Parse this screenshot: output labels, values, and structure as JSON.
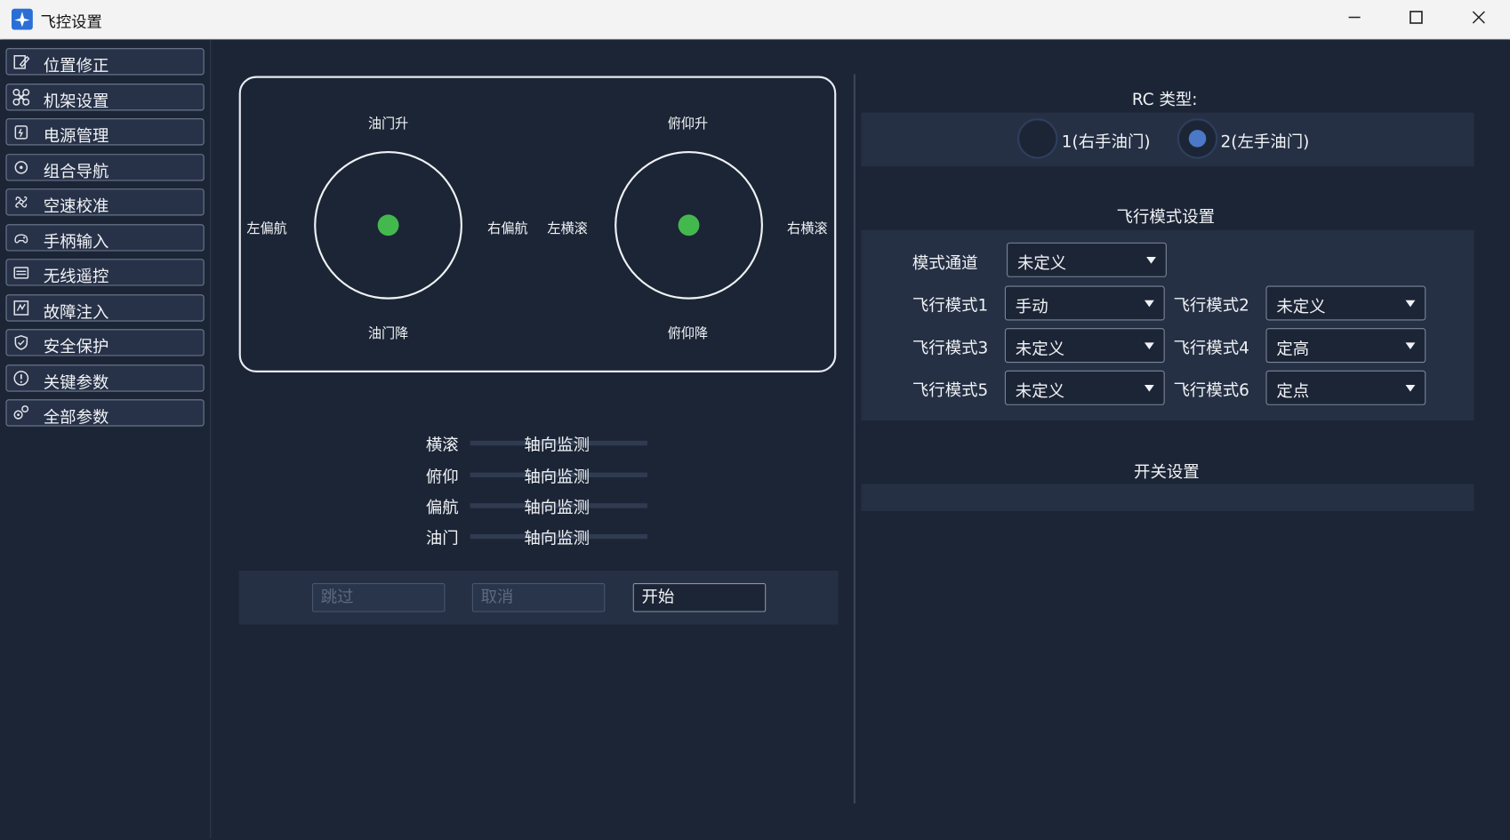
{
  "window": {
    "title": "飞控设置"
  },
  "sidebar": {
    "items": [
      {
        "label": "位置修正",
        "icon": "edit-icon"
      },
      {
        "label": "机架设置",
        "icon": "drone-icon"
      },
      {
        "label": "电源管理",
        "icon": "power-icon"
      },
      {
        "label": "组合导航",
        "icon": "nav-icon"
      },
      {
        "label": "空速校准",
        "icon": "fan-icon"
      },
      {
        "label": "手柄输入",
        "icon": "gamepad-icon"
      },
      {
        "label": "无线遥控",
        "icon": "remote-icon"
      },
      {
        "label": "故障注入",
        "icon": "fault-icon"
      },
      {
        "label": "安全保护",
        "icon": "shield-icon"
      },
      {
        "label": "关键参数",
        "icon": "alert-icon"
      },
      {
        "label": "全部参数",
        "icon": "gears-icon"
      }
    ]
  },
  "sticks": {
    "left": {
      "top": "油门升",
      "bottom": "油门降",
      "left": "左偏航",
      "right": "右偏航"
    },
    "right": {
      "top": "俯仰升",
      "bottom": "俯仰降",
      "left": "左横滚",
      "right": "右横滚"
    },
    "dot_color": "#43b94d"
  },
  "monitor": {
    "rows": [
      {
        "axis": "横滚",
        "text": "轴向监测"
      },
      {
        "axis": "俯仰",
        "text": "轴向监测"
      },
      {
        "axis": "偏航",
        "text": "轴向监测"
      },
      {
        "axis": "油门",
        "text": "轴向监测"
      }
    ]
  },
  "actions": {
    "skip": "跳过",
    "cancel": "取消",
    "start": "开始"
  },
  "rc": {
    "title": "RC 类型:",
    "option1": "1(右手油门)",
    "option2": "2(左手油门)",
    "selected": 2
  },
  "flight_modes": {
    "title": "飞行模式设置",
    "channel_label": "模式通道",
    "channel_value": "未定义",
    "modes": [
      {
        "label": "飞行模式1",
        "value": "手动"
      },
      {
        "label": "飞行模式2",
        "value": "未定义"
      },
      {
        "label": "飞行模式3",
        "value": "未定义"
      },
      {
        "label": "飞行模式4",
        "value": "定高"
      },
      {
        "label": "飞行模式5",
        "value": "未定义"
      },
      {
        "label": "飞行模式6",
        "value": "定点"
      }
    ]
  },
  "switch": {
    "title": "开关设置"
  }
}
